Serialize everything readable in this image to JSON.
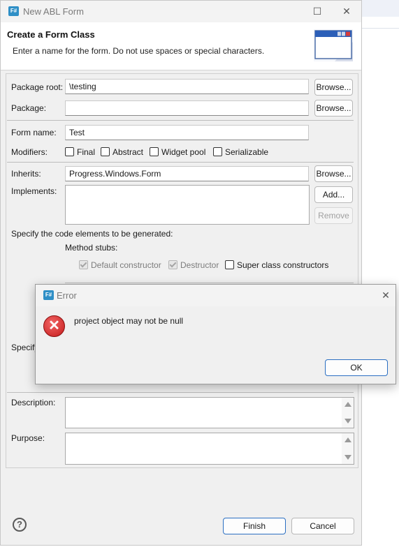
{
  "window": {
    "title": "New ABL Form",
    "banner_title": "Create a Form Class",
    "banner_message": "Enter a name for the form. Do not use spaces or special characters."
  },
  "form": {
    "package_root_label": "Package root:",
    "package_root_value": "\\testing",
    "package_label": "Package:",
    "package_value": "",
    "form_name_label": "Form name:",
    "form_name_value": "Test",
    "modifiers_label": "Modifiers:",
    "modifiers": [
      "Final",
      "Abstract",
      "Widget pool",
      "Serializable"
    ],
    "inherits_label": "Inherits:",
    "inherits_value": "Progress.Windows.Form",
    "implements_label": "Implements:",
    "code_elements_label": "Specify the code elements to be generated:",
    "method_stubs_label": "Method stubs:",
    "stubs": [
      {
        "label": "Default constructor",
        "checked": true,
        "disabled": true
      },
      {
        "label": "Destructor",
        "checked": true,
        "disabled": true
      },
      {
        "label": "Super class constructors",
        "checked": false,
        "disabled": false
      }
    ],
    "specify_partial": "Specify",
    "description_label": "Description:",
    "purpose_label": "Purpose:"
  },
  "buttons": {
    "browse": "Browse...",
    "add": "Add...",
    "remove": "Remove",
    "finish": "Finish",
    "cancel": "Cancel",
    "help": "?"
  },
  "error_dialog": {
    "title": "Error",
    "message": "project object may not be null",
    "ok": "OK"
  }
}
